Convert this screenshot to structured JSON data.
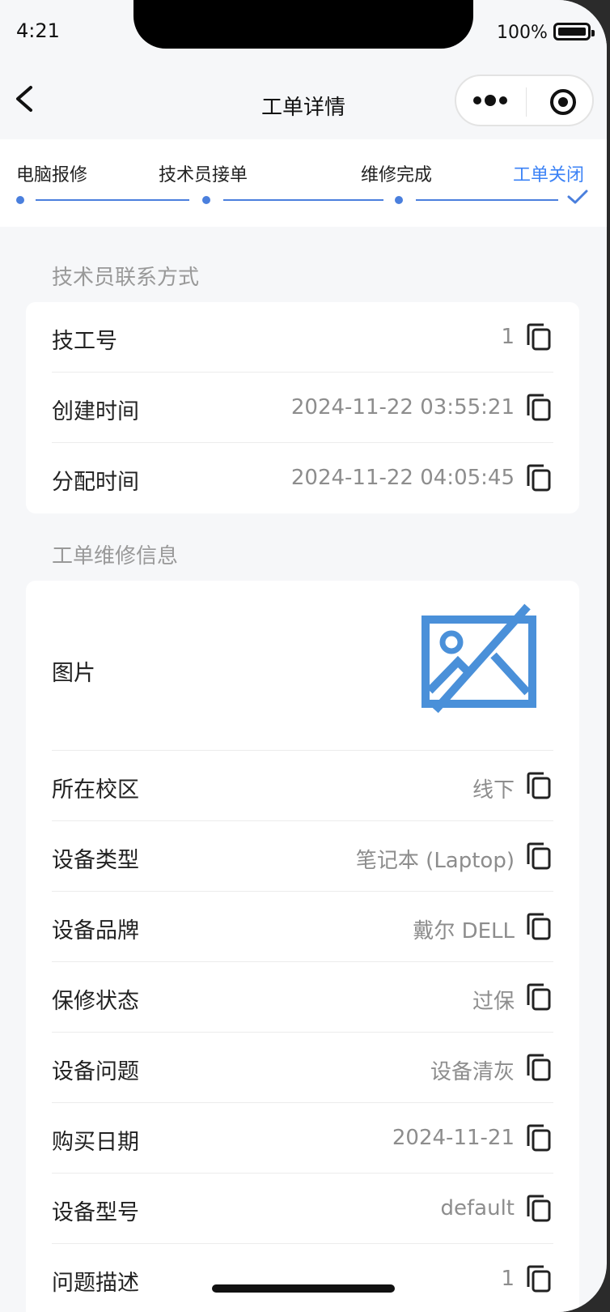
{
  "status_bar": {
    "time": "4:21",
    "battery": "100%"
  },
  "nav": {
    "title": "工单详情"
  },
  "progress": {
    "steps": [
      {
        "label": "电脑报修"
      },
      {
        "label": "技术员接单"
      },
      {
        "label": "维修完成"
      },
      {
        "label": "工单关闭"
      }
    ],
    "active_step": "工单关闭"
  },
  "tech_section": {
    "title": "技术员联系方式",
    "rows": [
      {
        "label": "技工号",
        "value": "1"
      },
      {
        "label": "创建时间",
        "value": "2024-11-22 03:55:21"
      },
      {
        "label": "分配时间",
        "value": "2024-11-22 04:05:45"
      }
    ]
  },
  "repair_section": {
    "title": "工单维修信息",
    "image_label": "图片",
    "rows": [
      {
        "label": "所在校区",
        "value": "线下"
      },
      {
        "label": "设备类型",
        "value": "笔记本 (Laptop)"
      },
      {
        "label": "设备品牌",
        "value": "戴尔 DELL"
      },
      {
        "label": "保修状态",
        "value": "过保"
      },
      {
        "label": "设备问题",
        "value": "设备清灰"
      },
      {
        "label": "购买日期",
        "value": "2024-11-21"
      },
      {
        "label": "设备型号",
        "value": "default"
      },
      {
        "label": "问题描述",
        "value": "1"
      }
    ]
  },
  "colors": {
    "accent": "#3b82f6",
    "image_icon": "#4a90d9",
    "muted_text": "#999999"
  }
}
